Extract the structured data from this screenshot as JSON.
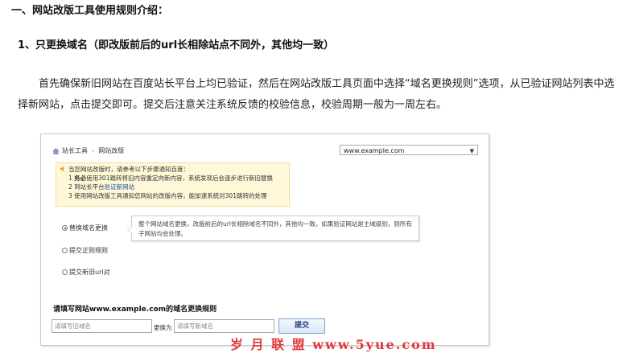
{
  "article": {
    "heading": "一、网站改版工具使用规则介绍：",
    "subheading": "1、只更换域名（即改版前后的url长相除站点不同外，其他均一致）",
    "paragraph": "首先确保新旧网站在百度站长平台上均已验证，然后在网站改版工具页面中选择“域名更换规则”选项，从已验证网站列表中选择新网站，点击提交即可。提交后注意关注系统反馈的校验信息，校验周期一般为一周左右。"
  },
  "screenshot": {
    "breadcrumb": [
      "站长工具",
      "网站改版"
    ],
    "domain_select": "www.example.com",
    "notice": {
      "intro": "当您网站改版时，请参考以下步骤通知百度：",
      "step1_prefix": "1 ",
      "step1_bold": "务必",
      "step1_rest": "使用301跳转将旧内容重定向新内容，系统发现后会逐步进行新旧替换",
      "step2_prefix": "2 到站长平台",
      "step2_link": "验证新网站",
      "step3": "3 使用网站改版工具通知您网站的改版内容，能加速系统对301跳转的处理"
    },
    "options": [
      {
        "label": "替换域名更换",
        "selected": true
      },
      {
        "label": "提交正则规则",
        "selected": false
      },
      {
        "label": "提交新旧url对",
        "selected": false
      }
    ],
    "tip": "整个网站域名更换，改版前后的url长相除域名不同外，其他均一致。如果验证网站是主域级别，则所有子网站均会处理。",
    "rules_title": "请填写网站www.example.com的域名更换规则",
    "old_placeholder": "请填写旧域名",
    "to_label": "更换为",
    "new_placeholder": "请填写新域名",
    "submit_label": "提交"
  },
  "watermark": "岁 月 联 盟  www.5yue.com"
}
